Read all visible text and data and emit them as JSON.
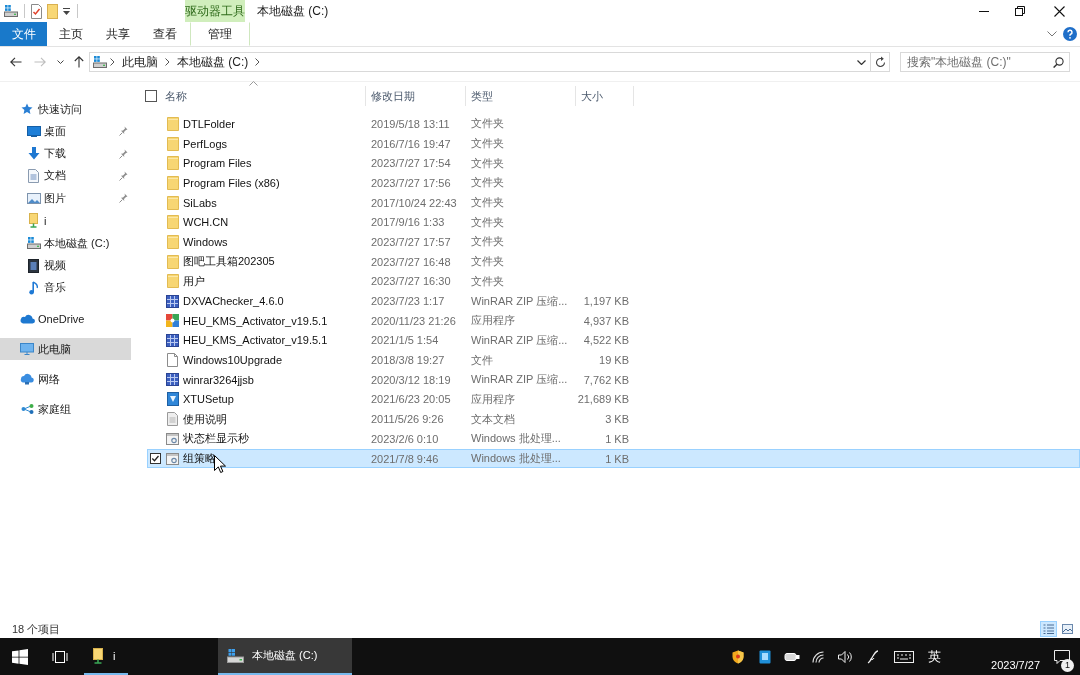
{
  "title_bar": {
    "contextual_tab": "驱动器工具",
    "title": "本地磁盘 (C:)"
  },
  "ribbon": {
    "tabs": [
      {
        "label": "文件",
        "kind": "file",
        "selected": false
      },
      {
        "label": "主页",
        "kind": "tab",
        "selected": false
      },
      {
        "label": "共享",
        "kind": "tab",
        "selected": false
      },
      {
        "label": "查看",
        "kind": "tab",
        "selected": false
      },
      {
        "label": "管理",
        "kind": "contextual",
        "selected": false
      }
    ]
  },
  "address_bar": {
    "path": [
      "此电脑",
      "本地磁盘 (C:)"
    ]
  },
  "search": {
    "placeholder": "搜索\"本地磁盘 (C:)\""
  },
  "navigation": {
    "items": [
      {
        "label": "快速访问",
        "kind": "quick_access",
        "selected": false,
        "children": [
          {
            "label": "桌面",
            "kind": "desktop",
            "pinned": true,
            "selected": false
          },
          {
            "label": "下载",
            "kind": "downloads",
            "pinned": true,
            "selected": false
          },
          {
            "label": "文档",
            "kind": "documents",
            "pinned": true,
            "selected": false
          },
          {
            "label": "图片",
            "kind": "pictures",
            "pinned": true,
            "selected": false
          },
          {
            "label": "i",
            "kind": "folder",
            "pinned": false,
            "selected": false
          },
          {
            "label": "本地磁盘 (C:)",
            "kind": "drive",
            "pinned": false,
            "selected": false
          },
          {
            "label": "视频",
            "kind": "videos",
            "pinned": false,
            "selected": false
          },
          {
            "label": "音乐",
            "kind": "music",
            "pinned": false,
            "selected": false
          }
        ]
      },
      {
        "label": "OneDrive",
        "kind": "onedrive",
        "selected": false
      },
      {
        "label": "此电脑",
        "kind": "this_pc",
        "selected": true
      },
      {
        "label": "网络",
        "kind": "network",
        "selected": false
      },
      {
        "label": "家庭组",
        "kind": "homegroup",
        "selected": false
      }
    ]
  },
  "file_list": {
    "select_all_checked": false,
    "columns": [
      {
        "label": "名称",
        "sorted": true
      },
      {
        "label": "修改日期",
        "sorted": false
      },
      {
        "label": "类型",
        "sorted": false
      },
      {
        "label": "大小",
        "sorted": false
      }
    ],
    "rows": [
      {
        "name": "DTLFolder",
        "date": "2019/5/18 13:11",
        "type": "文件夹",
        "kind": "folder",
        "selected": false
      },
      {
        "name": "PerfLogs",
        "date": "2016/7/16 19:47",
        "type": "文件夹",
        "kind": "folder",
        "selected": false
      },
      {
        "name": "Program Files",
        "date": "2023/7/27 17:54",
        "type": "文件夹",
        "kind": "folder",
        "selected": false
      },
      {
        "name": "Program Files (x86)",
        "date": "2023/7/27 17:56",
        "type": "文件夹",
        "kind": "folder",
        "selected": false
      },
      {
        "name": "SiLabs",
        "date": "2017/10/24 22:43",
        "type": "文件夹",
        "kind": "folder",
        "selected": false
      },
      {
        "name": "WCH.CN",
        "date": "2017/9/16 1:33",
        "type": "文件夹",
        "kind": "folder",
        "selected": false
      },
      {
        "name": "Windows",
        "date": "2023/7/27 17:57",
        "type": "文件夹",
        "kind": "folder",
        "selected": false
      },
      {
        "name": "图吧工具箱202305",
        "date": "2023/7/27 16:48",
        "type": "文件夹",
        "kind": "folder",
        "selected": false
      },
      {
        "name": "用户",
        "date": "2023/7/27 16:30",
        "type": "文件夹",
        "kind": "folder",
        "selected": false
      },
      {
        "name": "DXVAChecker_4.6.0",
        "date": "2023/7/23 1:17",
        "type": "WinRAR ZIP 压缩...",
        "size": "1,197 KB",
        "kind": "archive",
        "selected": false
      },
      {
        "name": "HEU_KMS_Activator_v19.5.1",
        "date": "2020/11/23 21:26",
        "type": "应用程序",
        "size": "4,937 KB",
        "kind": "program",
        "selected": false
      },
      {
        "name": "HEU_KMS_Activator_v19.5.1",
        "date": "2021/1/5 1:54",
        "type": "WinRAR ZIP 压缩...",
        "size": "4,522 KB",
        "kind": "archive",
        "selected": false
      },
      {
        "name": "Windows10Upgrade",
        "date": "2018/3/8 19:27",
        "type": "文件",
        "size": "19 KB",
        "kind": "file",
        "selected": false
      },
      {
        "name": "winrar3264jjsb",
        "date": "2020/3/12 18:19",
        "type": "WinRAR ZIP 压缩...",
        "size": "7,762 KB",
        "kind": "archive",
        "selected": false
      },
      {
        "name": "XTUSetup",
        "date": "2021/6/23 20:05",
        "type": "应用程序",
        "size": "21,689 KB",
        "kind": "installer",
        "selected": false
      },
      {
        "name": "使用说明",
        "date": "2011/5/26 9:26",
        "type": "文本文档",
        "size": "3 KB",
        "kind": "text",
        "selected": false
      },
      {
        "name": "状态栏显示秒",
        "date": "2023/2/6 0:10",
        "type": "Windows 批处理...",
        "size": "1 KB",
        "kind": "batch",
        "selected": false
      },
      {
        "name": "组策略",
        "date": "2021/7/8 9:46",
        "type": "Windows 批处理...",
        "size": "1 KB",
        "kind": "batch",
        "selected": true
      }
    ]
  },
  "status_bar": {
    "item_count": "18 个项目",
    "views": [
      {
        "kind": "details",
        "selected": true
      },
      {
        "kind": "large_icons",
        "selected": false
      }
    ]
  },
  "taskbar": {
    "apps": [
      {
        "label": "i",
        "kind": "folder",
        "selected": false
      },
      {
        "label": "本地磁盘 (C:)",
        "kind": "drive",
        "selected": true
      }
    ],
    "input_language": "英",
    "date": "2023/7/27",
    "notification_count": "1"
  }
}
